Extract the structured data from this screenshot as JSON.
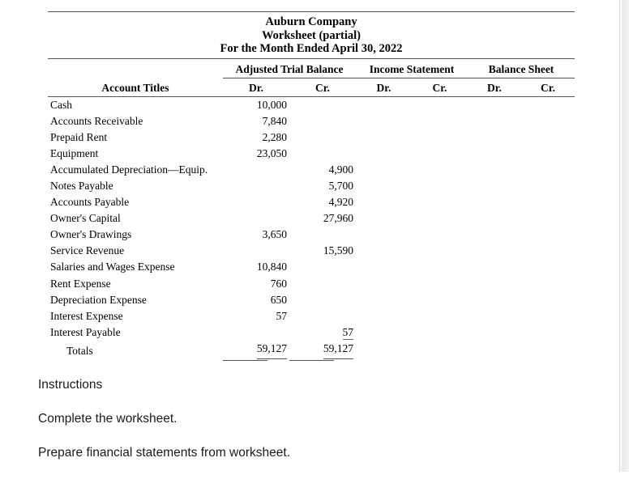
{
  "document": {
    "company": "Auburn Company",
    "doc_title": "Worksheet (partial)",
    "period": "For the Month Ended April 30, 2022"
  },
  "table": {
    "account_titles_header": "Account Titles",
    "column_groups": [
      {
        "label": "Adjusted Trial Balance"
      },
      {
        "label": "Income Statement"
      },
      {
        "label": "Balance Sheet"
      }
    ],
    "sub_headers": {
      "debit": "Dr.",
      "credit": "Cr."
    },
    "rows": [
      {
        "title": "Cash",
        "atb_dr": "10,000",
        "atb_cr": "",
        "is_dr": "",
        "is_cr": "",
        "bs_dr": "",
        "bs_cr": ""
      },
      {
        "title": "Accounts Receivable",
        "atb_dr": "7,840",
        "atb_cr": "",
        "is_dr": "",
        "is_cr": "",
        "bs_dr": "",
        "bs_cr": ""
      },
      {
        "title": "Prepaid Rent",
        "atb_dr": "2,280",
        "atb_cr": "",
        "is_dr": "",
        "is_cr": "",
        "bs_dr": "",
        "bs_cr": ""
      },
      {
        "title": "Equipment",
        "atb_dr": "23,050",
        "atb_cr": "",
        "is_dr": "",
        "is_cr": "",
        "bs_dr": "",
        "bs_cr": ""
      },
      {
        "title": "Accumulated Depreciation—Equip.",
        "atb_dr": "",
        "atb_cr": "4,900",
        "is_dr": "",
        "is_cr": "",
        "bs_dr": "",
        "bs_cr": ""
      },
      {
        "title": "Notes Payable",
        "atb_dr": "",
        "atb_cr": "5,700",
        "is_dr": "",
        "is_cr": "",
        "bs_dr": "",
        "bs_cr": ""
      },
      {
        "title": "Accounts Payable",
        "atb_dr": "",
        "atb_cr": "4,920",
        "is_dr": "",
        "is_cr": "",
        "bs_dr": "",
        "bs_cr": ""
      },
      {
        "title": "Owner's Capital",
        "atb_dr": "",
        "atb_cr": "27,960",
        "is_dr": "",
        "is_cr": "",
        "bs_dr": "",
        "bs_cr": ""
      },
      {
        "title": "Owner's Drawings",
        "atb_dr": "3,650",
        "atb_cr": "",
        "is_dr": "",
        "is_cr": "",
        "bs_dr": "",
        "bs_cr": ""
      },
      {
        "title": "Service Revenue",
        "atb_dr": "",
        "atb_cr": "15,590",
        "is_dr": "",
        "is_cr": "",
        "bs_dr": "",
        "bs_cr": ""
      },
      {
        "title": "Salaries and Wages Expense",
        "atb_dr": "10,840",
        "atb_cr": "",
        "is_dr": "",
        "is_cr": "",
        "bs_dr": "",
        "bs_cr": ""
      },
      {
        "title": "Rent Expense",
        "atb_dr": "760",
        "atb_cr": "",
        "is_dr": "",
        "is_cr": "",
        "bs_dr": "",
        "bs_cr": ""
      },
      {
        "title": "Depreciation Expense",
        "atb_dr": "650",
        "atb_cr": "",
        "is_dr": "",
        "is_cr": "",
        "bs_dr": "",
        "bs_cr": ""
      },
      {
        "title": "Interest Expense",
        "atb_dr": "57",
        "atb_cr": "",
        "is_dr": "",
        "is_cr": "",
        "bs_dr": "",
        "bs_cr": ""
      },
      {
        "title": "Interest Payable",
        "atb_dr": "",
        "atb_cr": "57",
        "is_dr": "",
        "is_cr": "",
        "bs_dr": "",
        "bs_cr": ""
      }
    ],
    "totals": {
      "title": "Totals",
      "atb_dr": "59,127",
      "atb_cr": "59,127",
      "is_dr": "",
      "is_cr": "",
      "bs_dr": "",
      "bs_cr": ""
    }
  },
  "instructions": {
    "heading": "Instructions",
    "items": [
      "Complete the worksheet.",
      "Prepare financial statements from worksheet."
    ]
  },
  "colors": {
    "text": "#000000",
    "rule": "#555555",
    "page_background": "#ffffff"
  }
}
